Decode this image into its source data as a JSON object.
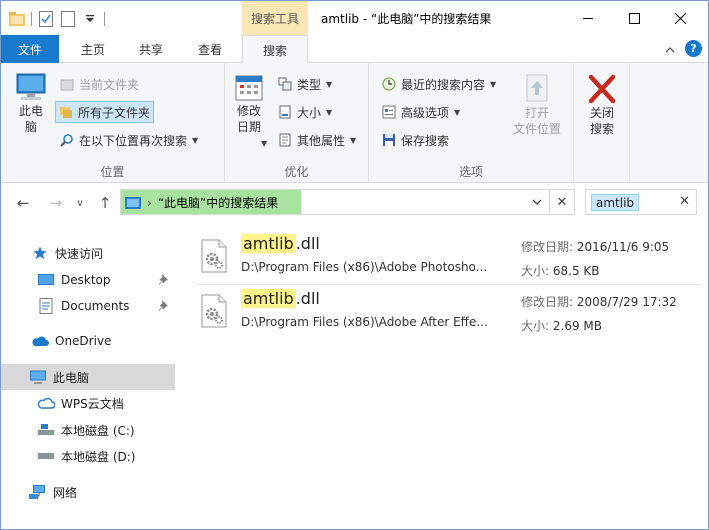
{
  "titlebar": {
    "context_tab": "搜索工具",
    "title": "amtlib - “此电脑”中的搜索结果"
  },
  "tabs": {
    "file": "文件",
    "home": "主页",
    "share": "共享",
    "view": "查看",
    "search": "搜索"
  },
  "ribbon": {
    "location": {
      "this_pc_line1": "此电",
      "this_pc_line2": "脑",
      "current_folder": "当前文件夹",
      "all_subfolders": "所有子文件夹",
      "search_again": "在以下位置再次搜索",
      "label": "位置"
    },
    "refine": {
      "date_modified_line1": "修改",
      "date_modified_line2": "日期",
      "kind": "类型",
      "size": "大小",
      "other_properties": "其他属性",
      "label": "优化"
    },
    "options": {
      "recent_searches": "最近的搜索内容",
      "advanced_options": "高级选项",
      "save_search": "保存搜索",
      "open_location_line1": "打开",
      "open_location_line2": "文件位置",
      "label": "选项"
    },
    "close": {
      "line1": "关闭",
      "line2": "搜索"
    }
  },
  "address": {
    "path": "“此电脑”中的搜索结果",
    "chevron": "›"
  },
  "search": {
    "query": "amtlib"
  },
  "nav": {
    "quick_access": "快速访问",
    "desktop": "Desktop",
    "documents": "Documents",
    "onedrive": "OneDrive",
    "this_pc": "此电脑",
    "wps": "WPS云文档",
    "disk_c": "本地磁盘 (C:)",
    "disk_d": "本地磁盘 (D:)",
    "network": "网络"
  },
  "results": [
    {
      "name_match": "amtlib",
      "name_rest": ".dll",
      "path": "D:\\Program Files (x86)\\Adobe Photosho...",
      "modified_label": "修改日期:",
      "modified": "2016/11/6 9:05",
      "size_label": "大小:",
      "size": "68.5 KB"
    },
    {
      "name_match": "amtlib",
      "name_rest": ".dll",
      "path": "D:\\Program Files (x86)\\Adobe After Effe...",
      "modified_label": "修改日期:",
      "modified": "2008/7/29 17:32",
      "size_label": "大小:",
      "size": "2.69 MB"
    }
  ],
  "colors": {
    "file_tab": "#1979ca",
    "context_tab": "#fbe6b5",
    "address_highlight": "#a8e4a0",
    "match_highlight": "#fff38a"
  }
}
